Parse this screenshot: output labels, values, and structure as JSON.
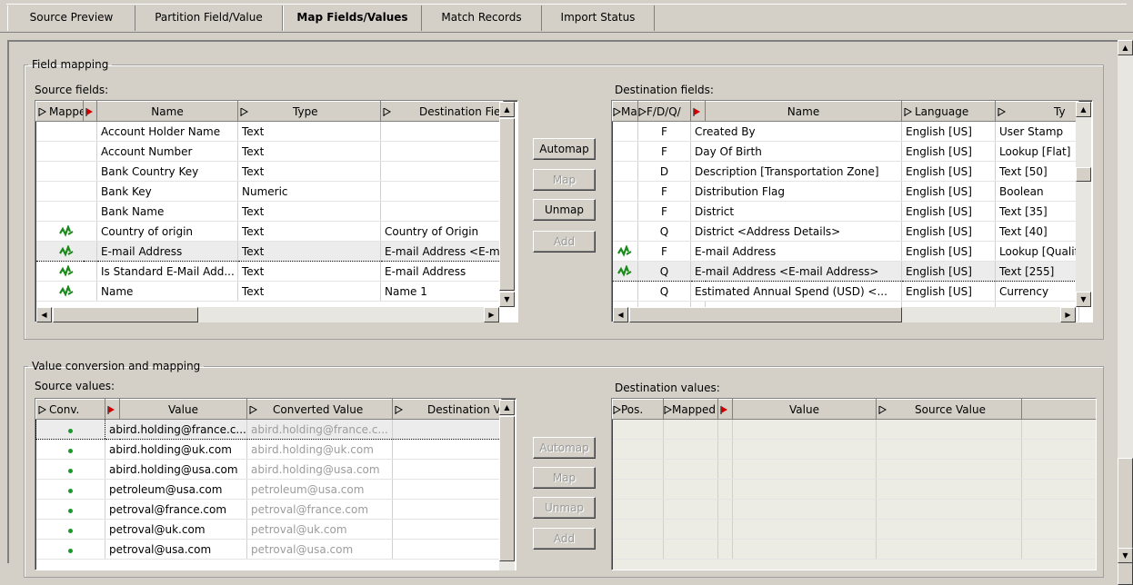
{
  "tabs": [
    "Source Preview",
    "Partition Field/Value",
    "Map Fields/Values",
    "Match Records",
    "Import Status"
  ],
  "active_tab": "Map Fields/Values",
  "field_mapping": {
    "legend": "Field mapping",
    "source_label": "Source fields:",
    "dest_label": "Destination fields:",
    "source_columns": [
      "Mapped",
      "",
      "Name",
      "Type",
      "Destination Fie"
    ],
    "source_rows": [
      {
        "mapped": false,
        "name": "Account Holder Name",
        "type": "Text",
        "dest": ""
      },
      {
        "mapped": false,
        "name": "Account Number",
        "type": "Text",
        "dest": ""
      },
      {
        "mapped": false,
        "name": "Bank Country Key",
        "type": "Text",
        "dest": ""
      },
      {
        "mapped": false,
        "name": "Bank Key",
        "type": "Numeric",
        "dest": ""
      },
      {
        "mapped": false,
        "name": "Bank Name",
        "type": "Text",
        "dest": ""
      },
      {
        "mapped": true,
        "name": "Country of origin",
        "type": "Text",
        "dest": "Country of Origin"
      },
      {
        "mapped": true,
        "name": "E-mail Address",
        "type": "Text",
        "dest": "E-mail Address <E-m",
        "selected": true
      },
      {
        "mapped": true,
        "name": "Is Standard E-Mail Add...",
        "type": "Text",
        "dest": "E-mail Address"
      },
      {
        "mapped": true,
        "name": "Name",
        "type": "Text",
        "dest": "Name 1"
      }
    ],
    "dest_columns": [
      "Ma",
      "F/D/Q/",
      "",
      "Name",
      "Language",
      "Ty"
    ],
    "dest_rows": [
      {
        "mapped": false,
        "fdq": "F",
        "name": "Created By",
        "lang": "English [US]",
        "type": "User Stamp"
      },
      {
        "mapped": false,
        "fdq": "F",
        "name": "Day Of Birth",
        "lang": "English [US]",
        "type": "Lookup [Flat]"
      },
      {
        "mapped": false,
        "fdq": "D",
        "name": "Description [Transportation Zone]",
        "lang": "English [US]",
        "type": "Text [50]"
      },
      {
        "mapped": false,
        "fdq": "F",
        "name": "Distribution Flag",
        "lang": "English [US]",
        "type": "Boolean"
      },
      {
        "mapped": false,
        "fdq": "F",
        "name": "District",
        "lang": "English [US]",
        "type": "Text [35]"
      },
      {
        "mapped": false,
        "fdq": "Q",
        "name": "District <Address Details>",
        "lang": "English [US]",
        "type": "Text [40]"
      },
      {
        "mapped": true,
        "fdq": "F",
        "name": "E-mail Address",
        "lang": "English [US]",
        "type": "Lookup [Qualified"
      },
      {
        "mapped": true,
        "fdq": "Q",
        "name": "E-mail Address <E-mail Address>",
        "lang": "English [US]",
        "type": "Text [255]",
        "selected": true
      },
      {
        "mapped": false,
        "fdq": "Q",
        "name": "Estimated Annual Spend (USD) <...",
        "lang": "English [US]",
        "type": "Currency"
      }
    ],
    "buttons": {
      "automap": "Automap",
      "map": "Map",
      "unmap": "Unmap",
      "add": "Add"
    }
  },
  "value_mapping": {
    "legend": "Value conversion and mapping",
    "source_label": "Source values:",
    "dest_label": "Destination values:",
    "source_columns": [
      "Conv.",
      "",
      "Value",
      "Converted Value",
      "Destination V"
    ],
    "source_rows": [
      {
        "value": "abird.holding@france.c...",
        "converted": "abird.holding@france.c...",
        "selected": true
      },
      {
        "value": "abird.holding@uk.com",
        "converted": "abird.holding@uk.com"
      },
      {
        "value": "abird.holding@usa.com",
        "converted": "abird.holding@usa.com"
      },
      {
        "value": "petroleum@usa.com",
        "converted": "petroleum@usa.com"
      },
      {
        "value": "petroval@france.com",
        "converted": "petroval@france.com"
      },
      {
        "value": "petroval@uk.com",
        "converted": "petroval@uk.com"
      },
      {
        "value": "petroval@usa.com",
        "converted": "petroval@usa.com"
      }
    ],
    "dest_columns": [
      "Pos.",
      "Mapped",
      "",
      "Value",
      "Source Value"
    ],
    "buttons": {
      "automap": "Automap",
      "map": "Map",
      "unmap": "Unmap",
      "add": "Add"
    }
  },
  "colors": {
    "map_icon": "#1a8a1a",
    "sort_red": "#cc0000"
  }
}
